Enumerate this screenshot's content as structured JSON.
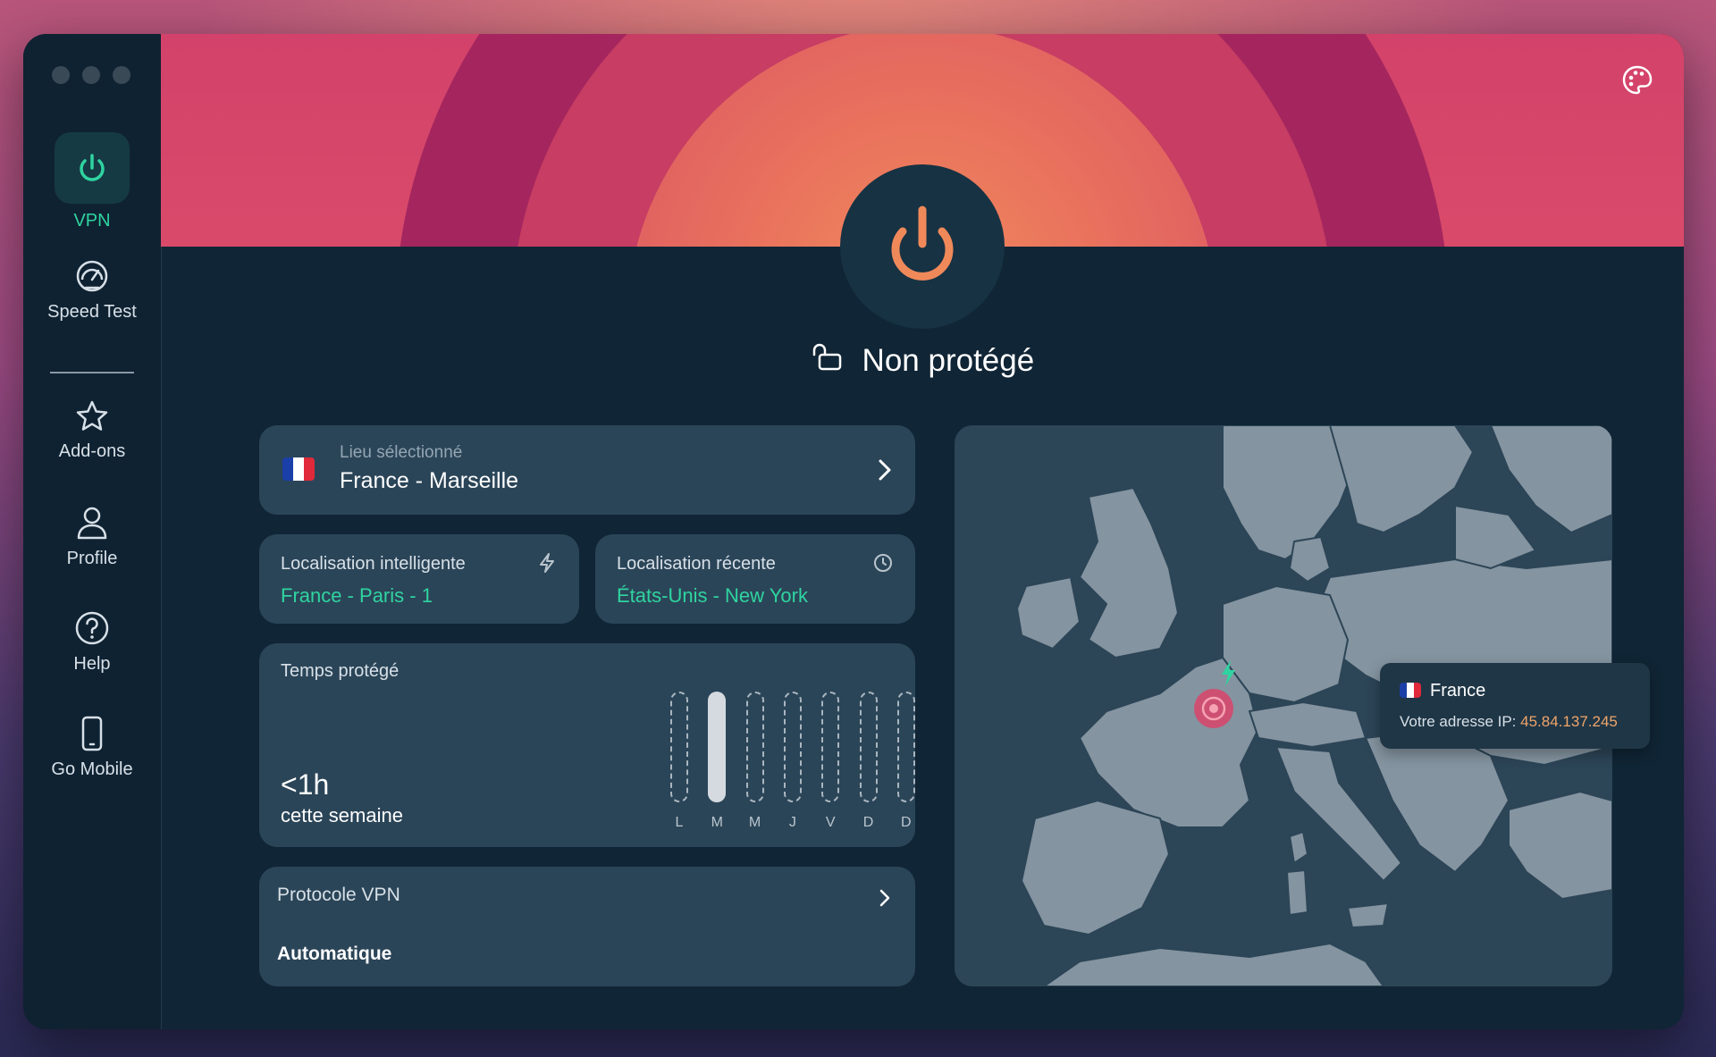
{
  "sidebar": {
    "items": [
      {
        "label": "VPN",
        "icon": "power-icon",
        "active": true
      },
      {
        "label": "Speed Test",
        "icon": "speedometer-icon"
      },
      {
        "label": "Add-ons",
        "icon": "star-icon"
      },
      {
        "label": "Profile",
        "icon": "user-icon"
      },
      {
        "label": "Help",
        "icon": "help-icon"
      },
      {
        "label": "Go Mobile",
        "icon": "phone-icon"
      }
    ]
  },
  "header": {
    "status": "Non protégé",
    "status_icon": "unlocked-icon",
    "theme_icon": "palette-icon"
  },
  "location": {
    "caption": "Lieu sélectionné",
    "value": "France - Marseille"
  },
  "smart": {
    "caption": "Localisation intelligente",
    "value": "France - Paris - 1",
    "icon": "bolt-icon"
  },
  "recent": {
    "caption": "Localisation récente",
    "value": "États-Unis - New York",
    "icon": "clock-icon"
  },
  "protected_time": {
    "title": "Temps protégé",
    "value": "<1h",
    "period": "cette semaine",
    "days": [
      "L",
      "M",
      "M",
      "J",
      "V",
      "D",
      "D"
    ],
    "filled_day_index": 1
  },
  "protocol": {
    "title": "Protocole VPN",
    "value": "Automatique"
  },
  "map": {
    "tooltip_country": "France",
    "ip_label": "Votre adresse IP:",
    "ip_value": "45.84.137.245"
  },
  "colors": {
    "accent_green": "#2fd4a0",
    "ip_orange": "#f0a56a",
    "power_orange": "#f0895a"
  }
}
